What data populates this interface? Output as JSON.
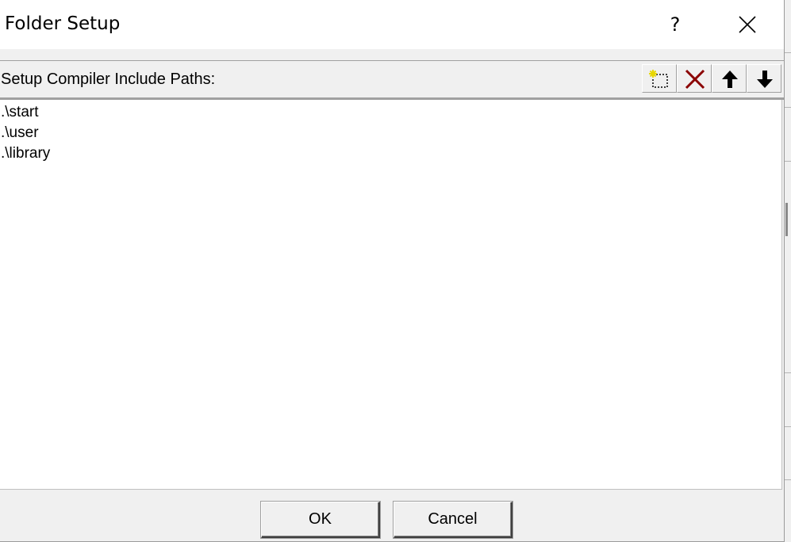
{
  "dialog": {
    "title": "Folder Setup",
    "help_label": "?",
    "close_icon": "close-icon"
  },
  "header": {
    "label": "Setup Compiler Include Paths:"
  },
  "toolbar": {
    "buttons": [
      {
        "name": "new-path-icon",
        "color": "#e8d700"
      },
      {
        "name": "delete-icon",
        "color": "#8b0000"
      },
      {
        "name": "move-up-icon",
        "color": "#000000"
      },
      {
        "name": "move-down-icon",
        "color": "#000000"
      }
    ]
  },
  "paths": [
    ".\\start",
    ".\\user",
    ".\\library"
  ],
  "buttons": {
    "ok": "OK",
    "cancel": "Cancel"
  }
}
